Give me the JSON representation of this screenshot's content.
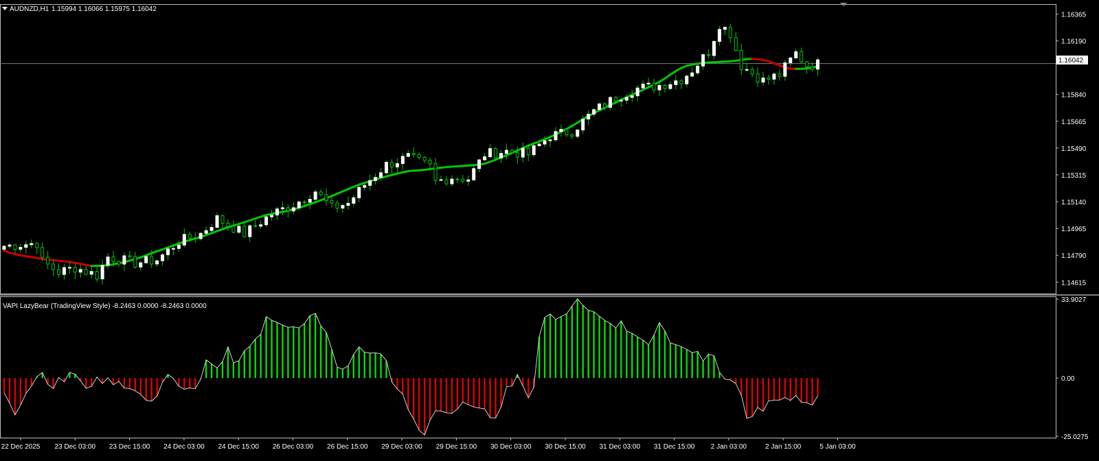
{
  "chart_data": [
    {
      "type": "candlestick",
      "symbol": "AUDNZD,H1",
      "ohlc_header": "1.15994 1.16066 1.15975 1.16042",
      "current_price_label": "1.16042",
      "ylim": [
        1.1454,
        1.1643
      ],
      "y_ticks": [
        "1.16365",
        "1.16190",
        "1.15840",
        "1.15665",
        "1.15490",
        "1.15315",
        "1.15140",
        "1.14965",
        "1.14790",
        "1.14615"
      ],
      "current_price": 1.16042,
      "candle_count": 150,
      "price_path": [
        [
          0,
          1.1485
        ],
        [
          6,
          1.1487
        ],
        [
          7,
          1.1475
        ],
        [
          10,
          1.1468
        ],
        [
          13,
          1.1471
        ],
        [
          17,
          1.1466
        ],
        [
          19,
          1.1478
        ],
        [
          24,
          1.1474
        ],
        [
          28,
          1.1476
        ],
        [
          32,
          1.1488
        ],
        [
          36,
          1.1493
        ],
        [
          39,
          1.1503
        ],
        [
          44,
          1.1493
        ],
        [
          49,
          1.1506
        ],
        [
          53,
          1.1512
        ],
        [
          57,
          1.1521
        ],
        [
          60,
          1.151
        ],
        [
          63,
          1.1513
        ],
        [
          66,
          1.1525
        ],
        [
          70,
          1.1538
        ],
        [
          74,
          1.1543
        ],
        [
          78,
          1.1537
        ],
        [
          79,
          1.1527
        ],
        [
          82,
          1.153
        ],
        [
          85,
          1.1529
        ],
        [
          88,
          1.1545
        ],
        [
          92,
          1.1547
        ],
        [
          96,
          1.1545
        ],
        [
          100,
          1.1557
        ],
        [
          104,
          1.156
        ],
        [
          108,
          1.1573
        ],
        [
          112,
          1.1582
        ],
        [
          116,
          1.1588
        ],
        [
          120,
          1.159
        ],
        [
          124,
          1.1594
        ],
        [
          126,
          1.16
        ],
        [
          129,
          1.1612
        ],
        [
          131,
          1.163
        ],
        [
          133,
          1.1624
        ],
        [
          135,
          1.1603
        ],
        [
          139,
          1.1593
        ],
        [
          142,
          1.1597
        ],
        [
          145,
          1.1611
        ],
        [
          147,
          1.1603
        ],
        [
          149,
          1.1604
        ]
      ],
      "ma_color_up": "#00c800",
      "ma_color_down": "#cc0000",
      "candle_up_color": "#ffffff",
      "candle_down_color": "#00c800"
    },
    {
      "type": "histogram",
      "title": "VAPI LazyBear (TradingView Style) -8.2463 0.0000 -8.2463 0.0000",
      "y_ticks": [
        "33.9027",
        "0.00",
        "-25.0275"
      ],
      "ylim": [
        -25.0275,
        33.9027
      ],
      "positive_color": "#00e000",
      "negative_color": "#e00000",
      "bar_count": 150,
      "profile": [
        [
          0,
          -6
        ],
        [
          2,
          -16
        ],
        [
          4,
          -7
        ],
        [
          6,
          1
        ],
        [
          7,
          3
        ],
        [
          8,
          -3
        ],
        [
          9,
          -5
        ],
        [
          10,
          0
        ],
        [
          11,
          -1
        ],
        [
          12,
          3
        ],
        [
          13,
          2
        ],
        [
          14,
          -1
        ],
        [
          15,
          -5
        ],
        [
          16,
          -3
        ],
        [
          17,
          1
        ],
        [
          18,
          -2
        ],
        [
          19,
          0
        ],
        [
          20,
          -3
        ],
        [
          21,
          -1
        ],
        [
          22,
          -4
        ],
        [
          24,
          -5
        ],
        [
          26,
          -9
        ],
        [
          27,
          -10
        ],
        [
          28,
          -8
        ],
        [
          29,
          -2
        ],
        [
          30,
          1
        ],
        [
          31,
          0
        ],
        [
          32,
          -4
        ],
        [
          33,
          -5
        ],
        [
          35,
          -4
        ],
        [
          36,
          0
        ],
        [
          37,
          8
        ],
        [
          38,
          6
        ],
        [
          39,
          4
        ],
        [
          40,
          7
        ],
        [
          41,
          13
        ],
        [
          42,
          6
        ],
        [
          43,
          7
        ],
        [
          44,
          12
        ],
        [
          45,
          14
        ],
        [
          47,
          19
        ],
        [
          48,
          26
        ],
        [
          50,
          24
        ],
        [
          52,
          22
        ],
        [
          54,
          21
        ],
        [
          55,
          24
        ],
        [
          56,
          27
        ],
        [
          57,
          28
        ],
        [
          58,
          22
        ],
        [
          59,
          19
        ],
        [
          60,
          12
        ],
        [
          61,
          5
        ],
        [
          62,
          4
        ],
        [
          63,
          5
        ],
        [
          64,
          10
        ],
        [
          65,
          13
        ],
        [
          66,
          11
        ],
        [
          67,
          11
        ],
        [
          69,
          10
        ],
        [
          70,
          7
        ],
        [
          71,
          -2
        ],
        [
          72,
          -5
        ],
        [
          73,
          -7
        ],
        [
          74,
          -13
        ],
        [
          75,
          -18
        ],
        [
          76,
          -23
        ],
        [
          77,
          -24
        ],
        [
          78,
          -18
        ],
        [
          79,
          -14
        ],
        [
          80,
          -14
        ],
        [
          82,
          -15
        ],
        [
          83,
          -13
        ],
        [
          84,
          -10
        ],
        [
          86,
          -12
        ],
        [
          88,
          -13
        ],
        [
          89,
          -17
        ],
        [
          90,
          -17
        ],
        [
          91,
          -12
        ],
        [
          92,
          -4
        ],
        [
          93,
          -3
        ],
        [
          94,
          2
        ],
        [
          95,
          -3
        ],
        [
          96,
          -8
        ],
        [
          97,
          -4
        ],
        [
          98,
          18
        ],
        [
          99,
          26
        ],
        [
          100,
          28
        ],
        [
          101,
          25
        ],
        [
          103,
          27
        ],
        [
          104,
          31
        ],
        [
          105,
          34
        ],
        [
          106,
          31
        ],
        [
          108,
          28
        ],
        [
          110,
          25
        ],
        [
          112,
          22
        ],
        [
          113,
          25
        ],
        [
          114,
          20
        ],
        [
          116,
          18
        ],
        [
          117,
          16
        ],
        [
          118,
          14
        ],
        [
          119,
          18
        ],
        [
          120,
          24
        ],
        [
          121,
          20
        ],
        [
          122,
          15
        ],
        [
          124,
          13
        ],
        [
          126,
          11
        ],
        [
          127,
          11
        ],
        [
          128,
          7
        ],
        [
          129,
          10
        ],
        [
          130,
          9
        ],
        [
          131,
          3
        ],
        [
          132,
          0
        ],
        [
          133,
          -1
        ],
        [
          134,
          -3
        ],
        [
          135,
          -8
        ],
        [
          136,
          -17
        ],
        [
          137,
          -16
        ],
        [
          138,
          -13
        ],
        [
          139,
          -14
        ],
        [
          140,
          -10
        ],
        [
          141,
          -10
        ],
        [
          142,
          -9
        ],
        [
          143,
          -8
        ],
        [
          144,
          -10
        ],
        [
          145,
          -7
        ],
        [
          146,
          -10
        ],
        [
          147,
          -11
        ],
        [
          148,
          -12
        ],
        [
          149,
          -8
        ]
      ]
    }
  ],
  "x_axis": {
    "labels": [
      "22 Dec 2025",
      "23 Dec 03:00",
      "23 Dec 15:00",
      "24 Dec 03:00",
      "24 Dec 15:00",
      "26 Dec 03:00",
      "26 Dec 15:00",
      "29 Dec 03:00",
      "29 Dec 15:00",
      "30 Dec 03:00",
      "30 Dec 15:00",
      "31 Dec 03:00",
      "31 Dec 15:00",
      "2 Jan 03:00",
      "2 Jan 15:00",
      "5 Jan 03:00"
    ]
  },
  "colors": {
    "background": "#000000",
    "grid": "#c0c0c0",
    "text": "#ffffff"
  }
}
